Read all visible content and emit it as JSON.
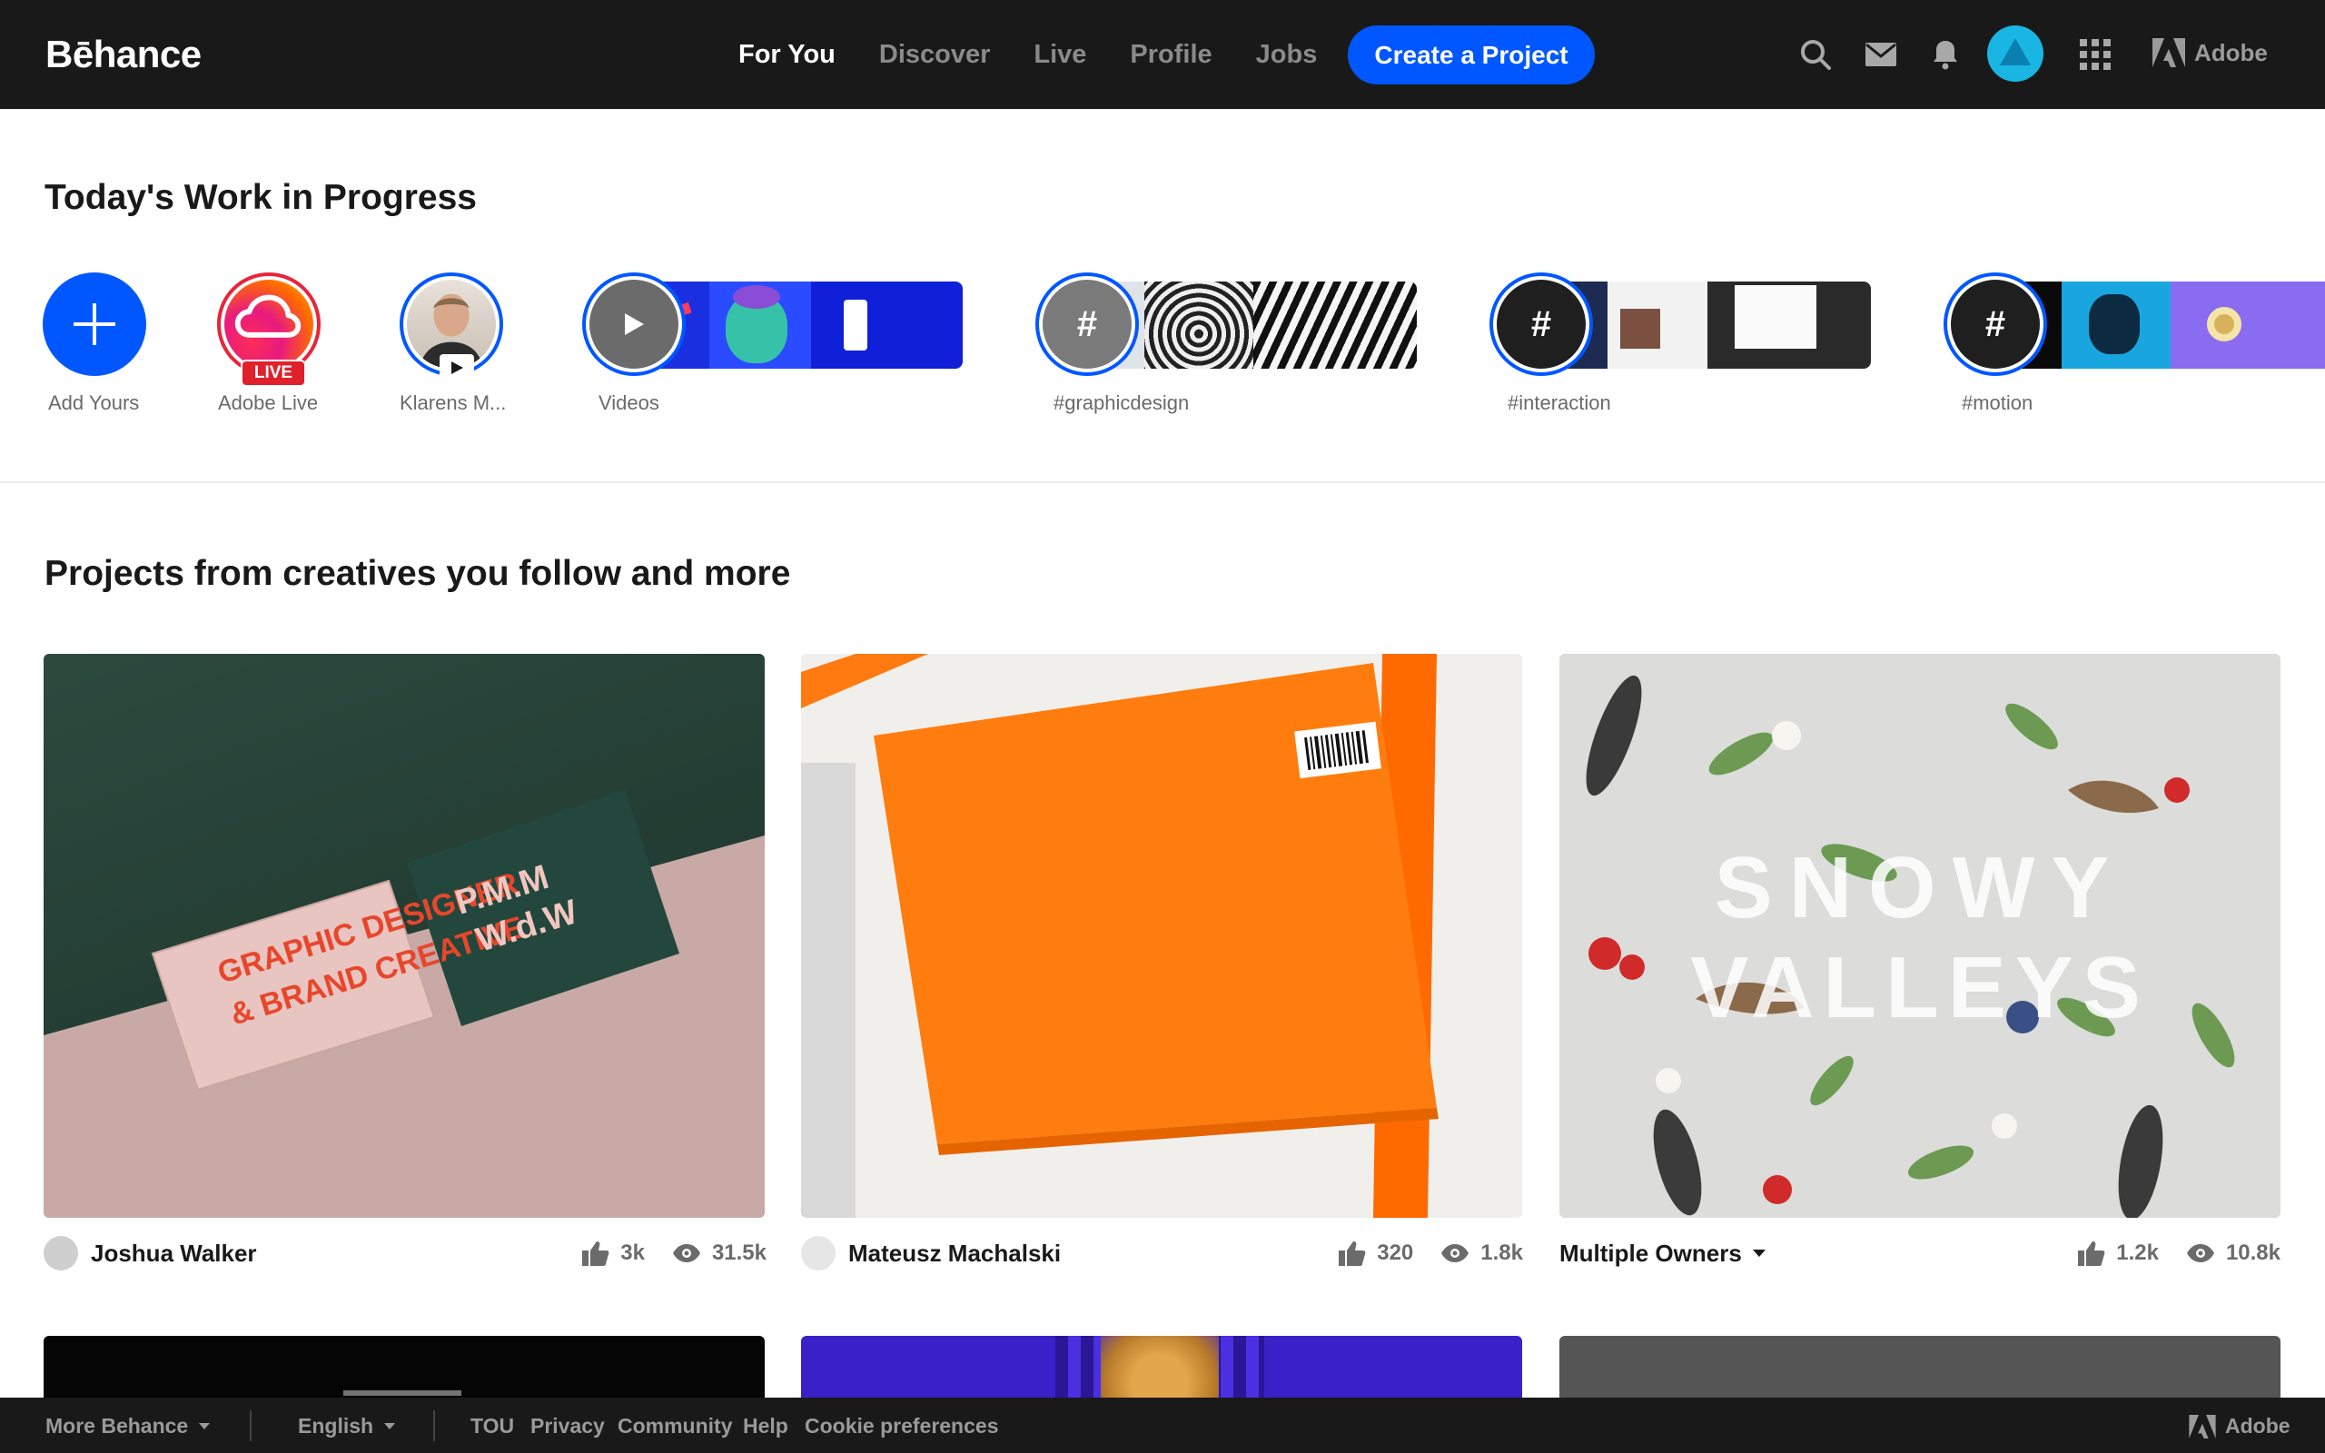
{
  "brand": {
    "logo_text": "Bēhance",
    "accent": "#0057ff",
    "topbar_bg": "#191919"
  },
  "nav": {
    "items": [
      {
        "label": "For You",
        "active": true
      },
      {
        "label": "Discover",
        "active": false
      },
      {
        "label": "Live",
        "active": false
      },
      {
        "label": "Profile",
        "active": false
      },
      {
        "label": "Jobs",
        "active": false
      }
    ],
    "create_label": "Create a Project",
    "icons": [
      "search-icon",
      "mail-icon",
      "bell-icon",
      "avatar",
      "apps-grid-icon"
    ],
    "adobe_label": "Adobe"
  },
  "wip": {
    "title": "Today's Work in Progress",
    "stories": [
      {
        "label": "Add Yours",
        "icon": "plus-icon"
      },
      {
        "label": "Adobe Live",
        "badge": "LIVE"
      },
      {
        "label": "Klarens M..."
      },
      {
        "label": "Videos",
        "icon": "play-icon"
      },
      {
        "label": "#graphicdesign",
        "icon": "hash-icon"
      },
      {
        "label": "#interaction",
        "icon": "hash-icon"
      },
      {
        "label": "#motion",
        "icon": "hash-icon"
      }
    ]
  },
  "projects": {
    "title": "Projects from creatives you follow and more",
    "cards": [
      {
        "owner": "Joshua Walker",
        "likes": "3k",
        "views": "31.5k",
        "cover_text_1": "GRAPHIC DESIGNER",
        "cover_text_2": "& BRAND CREATIVE"
      },
      {
        "owner": "Mateusz Machalski",
        "likes": "320",
        "views": "1.8k"
      },
      {
        "owner": "Multiple Owners",
        "likes": "1.2k",
        "views": "10.8k",
        "cover_text_1": "SNOWY",
        "cover_text_2": "VALLEYS"
      }
    ]
  },
  "footer": {
    "more_label": "More Behance",
    "language": "English",
    "links": [
      "TOU",
      "Privacy",
      "Community",
      "Help",
      "Cookie preferences"
    ],
    "adobe_label": "Adobe"
  }
}
